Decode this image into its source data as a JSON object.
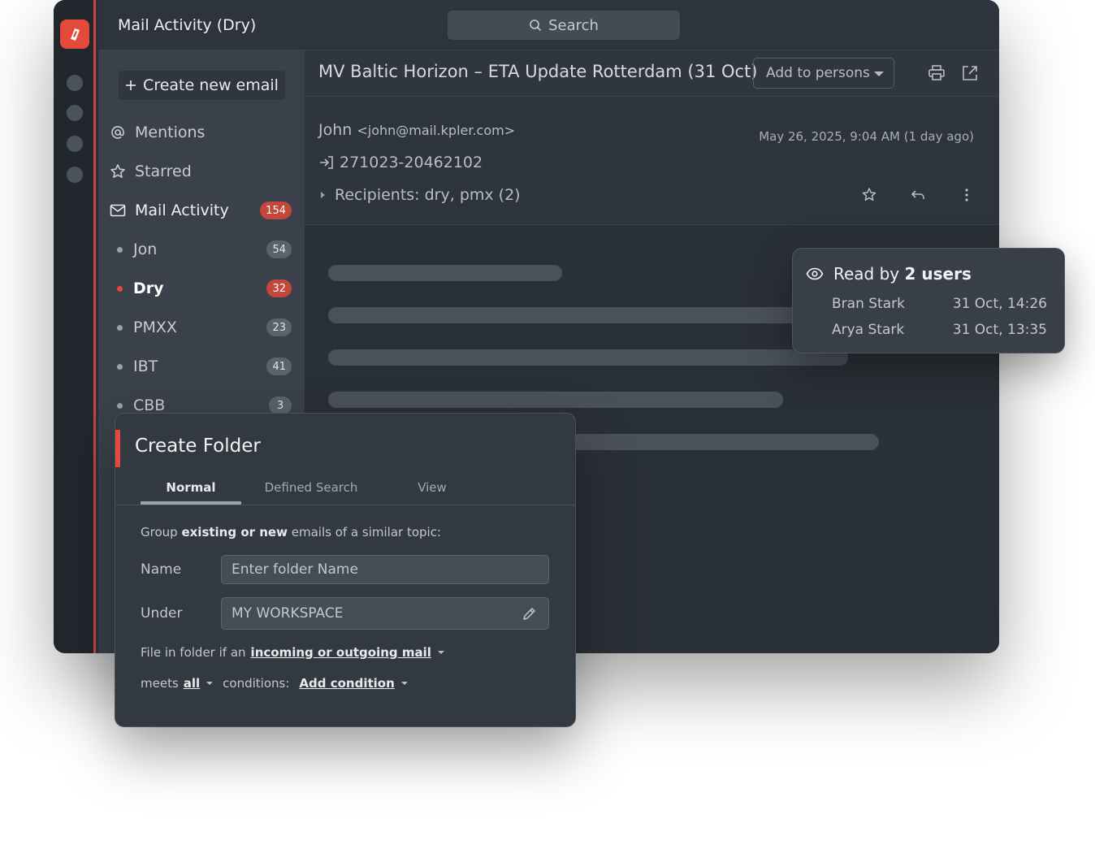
{
  "app": {
    "title": "Mail Activity (Dry)",
    "search_label": "Search"
  },
  "sidebar": {
    "create_label": "Create new email",
    "items": [
      {
        "label": "Mentions",
        "icon": "at-icon"
      },
      {
        "label": "Starred",
        "icon": "star-icon"
      },
      {
        "label": "Mail Activity",
        "icon": "mail-icon",
        "count": "154"
      }
    ],
    "folders": [
      {
        "label": "Jon",
        "count": "54"
      },
      {
        "label": "Dry",
        "count": "32",
        "active": true
      },
      {
        "label": "PMXX",
        "count": "23"
      },
      {
        "label": "IBT",
        "count": "41"
      },
      {
        "label": "CBB",
        "count": "3"
      }
    ]
  },
  "email": {
    "subject": "MV Baltic Horizon – ETA Update Rotterdam (31 Oct)",
    "add_persons_label": "Add to persons",
    "sender_name": "John",
    "sender_email": "<john@mail.kpler.com>",
    "date": "May 26, 2025, 9:04 AM (1 day ago)",
    "reference": "271023-20462102",
    "recipients": "Recipients: dry, pmx (2)"
  },
  "read_by": {
    "prefix": "Read by",
    "count_text": "2 users",
    "readers": [
      {
        "name": "Bran Stark",
        "time": "31 Oct, 14:26"
      },
      {
        "name": "Arya Stark",
        "time": "31 Oct, 13:35"
      }
    ]
  },
  "create_folder": {
    "title": "Create Folder",
    "tabs": [
      "Normal",
      "Defined Search",
      "View"
    ],
    "desc_pre": "Group",
    "desc_bold": "existing or new",
    "desc_post": "emails of a similar topic:",
    "name_label": "Name",
    "name_placeholder": "Enter folder Name",
    "under_label": "Under",
    "under_value": "MY WORKSPACE",
    "file_rule_pre": "File in folder if an",
    "file_rule_link": "incoming or outgoing mail",
    "meets_pre": "meets",
    "meets_link": "all",
    "conditions_label": "conditions:",
    "add_condition": "Add condition"
  },
  "colors": {
    "accent": "#e5493b",
    "badge_active": "#c4473d"
  }
}
